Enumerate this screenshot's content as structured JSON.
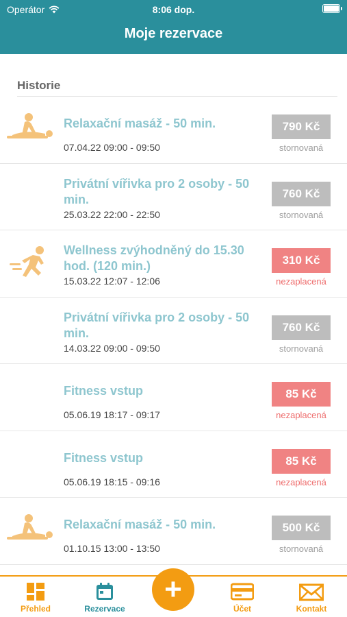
{
  "status_bar": {
    "carrier": "Operátor",
    "time": "8:06 dop."
  },
  "header": {
    "title": "Moje rezervace"
  },
  "section": {
    "title": "Historie"
  },
  "reservations": [
    {
      "name": "Relaxační masáž - 50 min.",
      "datetime": "07.04.22 09:00 - 09:50",
      "price": "790 Kč",
      "status": "stornovaná",
      "status_type": "gray",
      "icon": "massage-icon"
    },
    {
      "name": "Privátní vířivka pro 2 osoby - 50 min.",
      "datetime": "25.03.22 22:00 - 22:50",
      "price": "760 Kč",
      "status": "stornovaná",
      "status_type": "gray",
      "icon": ""
    },
    {
      "name": "Wellness zvýhodněný do 15.30 hod. (120 min.)",
      "datetime": "15.03.22 12:07 - 12:06",
      "price": "310 Kč",
      "status": "nezaplacená",
      "status_type": "red",
      "icon": "running-icon"
    },
    {
      "name": "Privátní vířivka pro 2 osoby - 50 min.",
      "datetime": "14.03.22 09:00 - 09:50",
      "price": "760 Kč",
      "status": "stornovaná",
      "status_type": "gray",
      "icon": ""
    },
    {
      "name": "Fitness vstup",
      "datetime": "05.06.19 18:17 - 09:17",
      "price": "85 Kč",
      "status": "nezaplacená",
      "status_type": "red",
      "icon": ""
    },
    {
      "name": "Fitness vstup",
      "datetime": "05.06.19 18:15 - 09:16",
      "price": "85 Kč",
      "status": "nezaplacená",
      "status_type": "red",
      "icon": ""
    },
    {
      "name": "Relaxační masáž - 50 min.",
      "datetime": "01.10.15 13:00 - 13:50",
      "price": "500 Kč",
      "status": "stornovaná",
      "status_type": "gray",
      "icon": "massage-icon"
    }
  ],
  "tabbar": {
    "overview": "Přehled",
    "reservations": "Rezervace",
    "add": "+",
    "account": "Účet",
    "contact": "Kontakt"
  },
  "colors": {
    "header": "#2a8f9c",
    "accent": "#f39c12",
    "unpaid": "#f08383",
    "cancelled": "#bdbdbd",
    "item_title": "#8ec6cf"
  }
}
